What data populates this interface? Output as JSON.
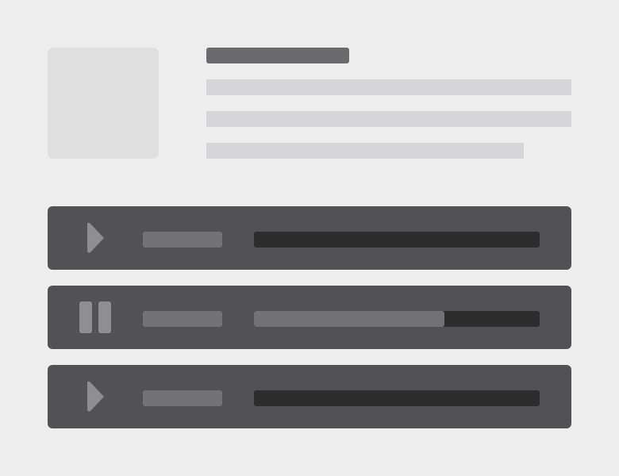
{
  "colors": {
    "background": "#ededed",
    "thumbnail": "#dedfe1",
    "title_placeholder": "#6b6b6f",
    "text_placeholder": "#d5d5d9",
    "track_bg": "#525256",
    "icon": "#8e8e93",
    "progress_bg": "#2d2d30",
    "progress_fill": "#737277"
  },
  "tracks": [
    {
      "state": "paused",
      "control_icon": "play-icon",
      "progress": 0
    },
    {
      "state": "playing",
      "control_icon": "pause-icon",
      "progress": 0.6667
    },
    {
      "state": "paused",
      "control_icon": "play-icon",
      "progress": 0
    }
  ]
}
